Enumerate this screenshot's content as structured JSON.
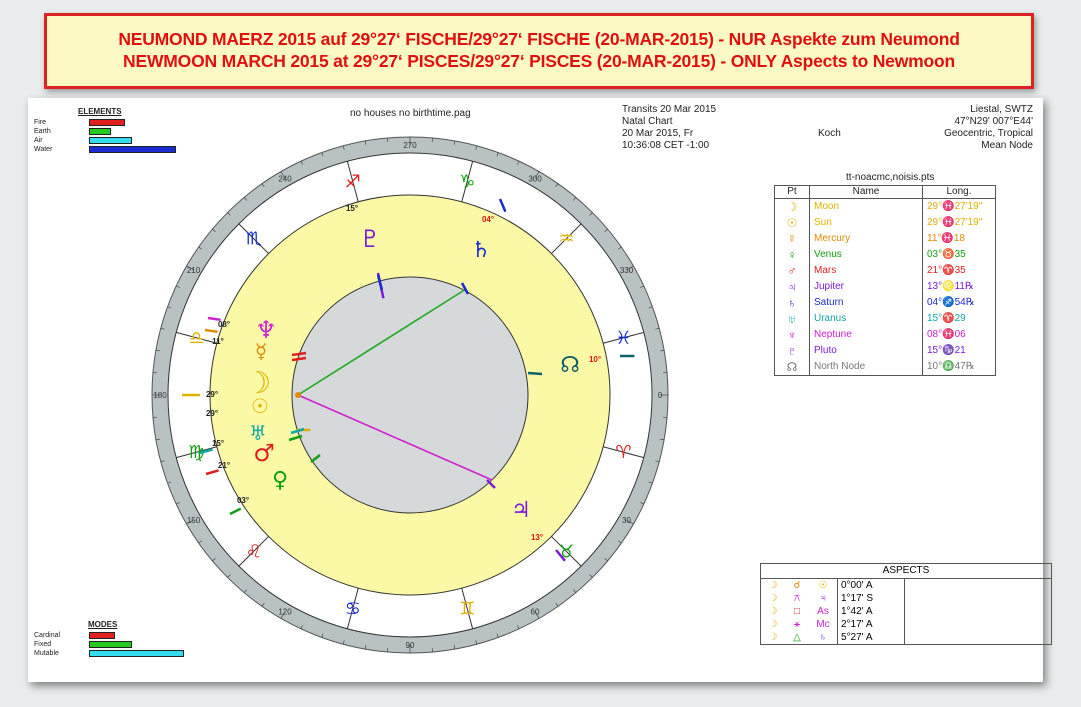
{
  "banner": {
    "line1": "NEUMOND MAERZ 2015 auf 29°27‘ FISCHE/29°27‘ FISCHE (20-MAR-2015) - NUR Aspekte zum Neumond",
    "line2": "NEWMOON MARCH 2015 at 29°27‘ PISCES/29°27‘ PISCES (20-MAR-2015) - ONLY Aspects to Newmoon",
    "color": "#e01010"
  },
  "header": {
    "center_title": "no houses no birthtime.pag",
    "chart_block": [
      "Transits 20 Mar 2015",
      "Natal Chart",
      "20 Mar 2015, Fr",
      "10:36:08 CET -1:00"
    ],
    "house_system": "Koch",
    "location_block": [
      "Liestal, SWTZ",
      "47°N29' 007°E44'",
      "Geocentric, Tropical",
      "Mean Node"
    ]
  },
  "elements": {
    "title": "ELEMENTS",
    "items": [
      {
        "label": "Fire",
        "value": 0.28,
        "color": "#e02020"
      },
      {
        "label": "Earth",
        "value": 0.17,
        "color": "#22cc22"
      },
      {
        "label": "Air",
        "value": 0.33,
        "color": "#33ddee"
      },
      {
        "label": "Water",
        "value": 0.67,
        "color": "#1a2bd0"
      }
    ]
  },
  "modes": {
    "title": "MODES",
    "items": [
      {
        "label": "Cardinal",
        "value": 0.2,
        "color": "#e02020"
      },
      {
        "label": "Fixed",
        "value": 0.33,
        "color": "#22cc22"
      },
      {
        "label": "Mutable",
        "value": 0.73,
        "color": "#33ddee"
      }
    ]
  },
  "planet_table": {
    "file": "tt-noacmc,noisis.pts",
    "headers": [
      "Pt",
      "Name",
      "Long."
    ],
    "rows": [
      {
        "glyph": "☽",
        "name": "Moon",
        "pos": "29°♓27'19\"",
        "color": "#e0b000"
      },
      {
        "glyph": "☉",
        "name": "Sun",
        "pos": "29°♓27'19\"",
        "color": "#e0b000"
      },
      {
        "glyph": "☿",
        "name": "Mercury",
        "pos": "11°♓18",
        "color": "#e08a00"
      },
      {
        "glyph": "♀",
        "name": "Venus",
        "pos": "03°♉35",
        "color": "#12a012"
      },
      {
        "glyph": "♂",
        "name": "Mars",
        "pos": "21°♈35",
        "color": "#e02020"
      },
      {
        "glyph": "♃",
        "name": "Jupiter",
        "pos": "13°♌11℞",
        "color": "#7a1ad8"
      },
      {
        "glyph": "♄",
        "name": "Saturn",
        "pos": "04°♐54℞",
        "color": "#1a2bd0"
      },
      {
        "glyph": "♅",
        "name": "Uranus",
        "pos": "15°♈29",
        "color": "#10a8a8"
      },
      {
        "glyph": "♆",
        "name": "Neptune",
        "pos": "08°♓06",
        "color": "#d020d0"
      },
      {
        "glyph": "♇",
        "name": "Pluto",
        "pos": "15°♑21",
        "color": "#7a1ad8"
      },
      {
        "glyph": "☊",
        "name": "North Node",
        "pos": "10°♎47℞",
        "color": "#777777"
      }
    ]
  },
  "aspects": {
    "title": "ASPECTS",
    "rows": [
      {
        "p1": "☽",
        "asp": "☌",
        "p2": "☉",
        "orb": "0°00' A",
        "c1": "#e0b000",
        "ca": "#e08a00",
        "c2": "#e0b000"
      },
      {
        "p1": "☽",
        "asp": "⚻",
        "p2": "♃",
        "orb": "1°17' S",
        "c1": "#e0b000",
        "ca": "#d020d0",
        "c2": "#7a1ad8"
      },
      {
        "p1": "☽",
        "asp": "□",
        "p2": "As",
        "orb": "1°42' A",
        "c1": "#e0b000",
        "ca": "#e02020",
        "c2": "#d020d0"
      },
      {
        "p1": "☽",
        "asp": "⚹",
        "p2": "Mc",
        "orb": "2°17' A",
        "c1": "#e0b000",
        "ca": "#d020d0",
        "c2": "#d020d0"
      },
      {
        "p1": "☽",
        "asp": "△",
        "p2": "♄",
        "orb": "5°27' A",
        "c1": "#e0b000",
        "ca": "#12a012",
        "c2": "#1a2bd0"
      }
    ]
  },
  "wheel": {
    "degree_labels": [
      "270",
      "240",
      "210",
      "180",
      "150",
      "120",
      "90",
      "60",
      "30",
      "0",
      "330",
      "300"
    ],
    "signs": [
      "♑",
      "♐",
      "♏",
      "♎",
      "♍",
      "♌",
      "♋",
      "♊",
      "♉",
      "♈",
      "♓",
      "♒"
    ],
    "planet_glyphs": [
      {
        "name": "pluto",
        "glyph": "♇",
        "color": "#7a1ad8",
        "deg_label": "15°"
      },
      {
        "name": "saturn",
        "glyph": "♄",
        "color": "#1a2bd0",
        "deg_label": "04°"
      },
      {
        "name": "node",
        "glyph": "☊",
        "color": "#10606a",
        "deg_label": "10°"
      },
      {
        "name": "jupiter",
        "glyph": "♃",
        "color": "#7a1ad8",
        "deg_label": "13°"
      },
      {
        "name": "venus",
        "glyph": "♀",
        "color": "#12a012",
        "deg_label": "03°"
      },
      {
        "name": "mars",
        "glyph": "♂",
        "color": "#e02020",
        "deg_label": "21°"
      },
      {
        "name": "uranus",
        "glyph": "♅",
        "color": "#10a8a8",
        "deg_label": "15°"
      },
      {
        "name": "sun",
        "glyph": "☉",
        "color": "#e0b000",
        "deg_label": "29°"
      },
      {
        "name": "moon",
        "glyph": "☽",
        "color": "#e0b000",
        "deg_label": "29°"
      },
      {
        "name": "mercury",
        "glyph": "☿",
        "color": "#e08a00",
        "deg_label": "11°"
      },
      {
        "name": "neptune",
        "glyph": "♆",
        "color": "#d020d0",
        "deg_label": "08°"
      }
    ]
  }
}
